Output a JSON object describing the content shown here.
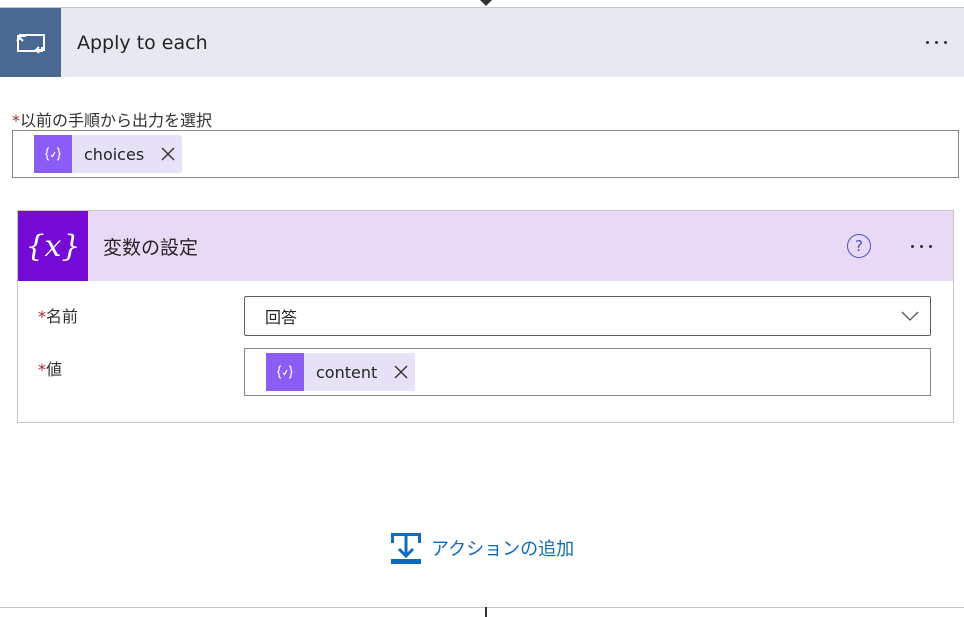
{
  "apply_each": {
    "title": "Apply to each",
    "select_label": "以前の手順から出力を選択",
    "required_mark": "*",
    "token": {
      "text": "choices",
      "icon": "expression-icon"
    }
  },
  "set_variable": {
    "title": "変数の設定",
    "icon_text": "{x}",
    "name_label": "名前",
    "name_value": "回答",
    "value_label": "値",
    "value_token": {
      "text": "content",
      "icon": "expression-icon"
    }
  },
  "add_action": {
    "label": "アクションの追加"
  },
  "colors": {
    "loop_accent": "#486991",
    "variable_accent": "#770bd6",
    "variable_header_bg": "#e8daf7",
    "token_icon": "#8b5cf6",
    "link": "#0f6cbd"
  }
}
